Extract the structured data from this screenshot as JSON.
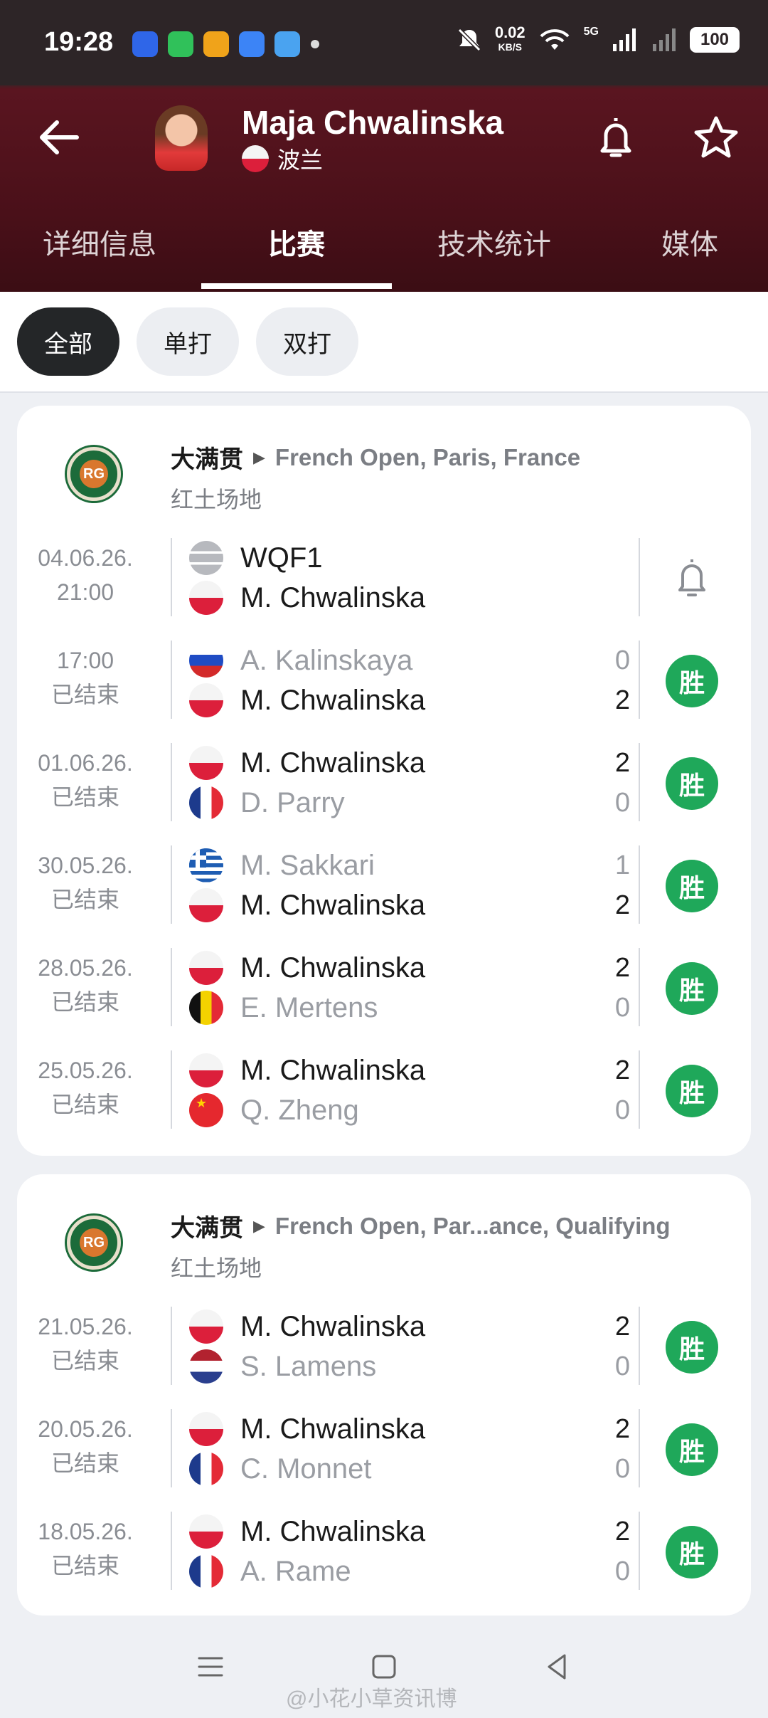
{
  "status_bar": {
    "time": "19:28",
    "net_speed_value": "0.02",
    "net_speed_unit": "KB/S",
    "signal_label": "5G",
    "battery": "100"
  },
  "player": {
    "name": "Maja Chwalinska",
    "country": "波兰"
  },
  "tabs": [
    {
      "label": "详细信息",
      "active": false
    },
    {
      "label": "比赛",
      "active": true
    },
    {
      "label": "技术统计",
      "active": false
    },
    {
      "label": "媒体",
      "active": false
    }
  ],
  "filters": [
    {
      "label": "全部",
      "active": true
    },
    {
      "label": "单打",
      "active": false
    },
    {
      "label": "双打",
      "active": false
    }
  ],
  "competitions": [
    {
      "category": "大满贯",
      "name": "French Open, Paris, France",
      "surface": "红土场地",
      "logo_text": "RG",
      "matches": [
        {
          "date": "04.06.26.",
          "status": "21:00",
          "p1": {
            "flag": "tbd",
            "name": "WQF1",
            "score": "",
            "winner": true
          },
          "p2": {
            "flag": "pl",
            "name": "M. Chwalinska",
            "score": "",
            "winner": true
          },
          "result": "bell"
        },
        {
          "date": "17:00",
          "status": "已结束",
          "p1": {
            "flag": "ru",
            "name": "A. Kalinskaya",
            "score": "0",
            "winner": false
          },
          "p2": {
            "flag": "pl",
            "name": "M. Chwalinska",
            "score": "2",
            "winner": true
          },
          "result": "胜"
        },
        {
          "date": "01.06.26.",
          "status": "已结束",
          "p1": {
            "flag": "pl",
            "name": "M. Chwalinska",
            "score": "2",
            "winner": true
          },
          "p2": {
            "flag": "fr",
            "name": "D. Parry",
            "score": "0",
            "winner": false
          },
          "result": "胜"
        },
        {
          "date": "30.05.26.",
          "status": "已结束",
          "p1": {
            "flag": "gr",
            "name": "M. Sakkari",
            "score": "1",
            "winner": false
          },
          "p2": {
            "flag": "pl",
            "name": "M. Chwalinska",
            "score": "2",
            "winner": true
          },
          "result": "胜"
        },
        {
          "date": "28.05.26.",
          "status": "已结束",
          "p1": {
            "flag": "pl",
            "name": "M. Chwalinska",
            "score": "2",
            "winner": true
          },
          "p2": {
            "flag": "be",
            "name": "E. Mertens",
            "score": "0",
            "winner": false
          },
          "result": "胜"
        },
        {
          "date": "25.05.26.",
          "status": "已结束",
          "p1": {
            "flag": "pl",
            "name": "M. Chwalinska",
            "score": "2",
            "winner": true
          },
          "p2": {
            "flag": "cn",
            "name": "Q. Zheng",
            "score": "0",
            "winner": false
          },
          "result": "胜"
        }
      ]
    },
    {
      "category": "大满贯",
      "name": "French Open, Par...ance, Qualifying",
      "surface": "红土场地",
      "logo_text": "RG",
      "matches": [
        {
          "date": "21.05.26.",
          "status": "已结束",
          "p1": {
            "flag": "pl",
            "name": "M. Chwalinska",
            "score": "2",
            "winner": true
          },
          "p2": {
            "flag": "nl",
            "name": "S. Lamens",
            "score": "0",
            "winner": false
          },
          "result": "胜"
        },
        {
          "date": "20.05.26.",
          "status": "已结束",
          "p1": {
            "flag": "pl",
            "name": "M. Chwalinska",
            "score": "2",
            "winner": true
          },
          "p2": {
            "flag": "fr",
            "name": "C. Monnet",
            "score": "0",
            "winner": false
          },
          "result": "胜"
        },
        {
          "date": "18.05.26.",
          "status": "已结束",
          "p1": {
            "flag": "pl",
            "name": "M. Chwalinska",
            "score": "2",
            "winner": true
          },
          "p2": {
            "flag": "fr",
            "name": "A. Rame",
            "score": "0",
            "winner": false
          },
          "result": "胜"
        }
      ]
    }
  ],
  "watermark": "@小花小草资讯博",
  "colors": {
    "header_bg": "#4a1019",
    "win_badge": "#1fa85a",
    "active_chip": "#242628"
  }
}
